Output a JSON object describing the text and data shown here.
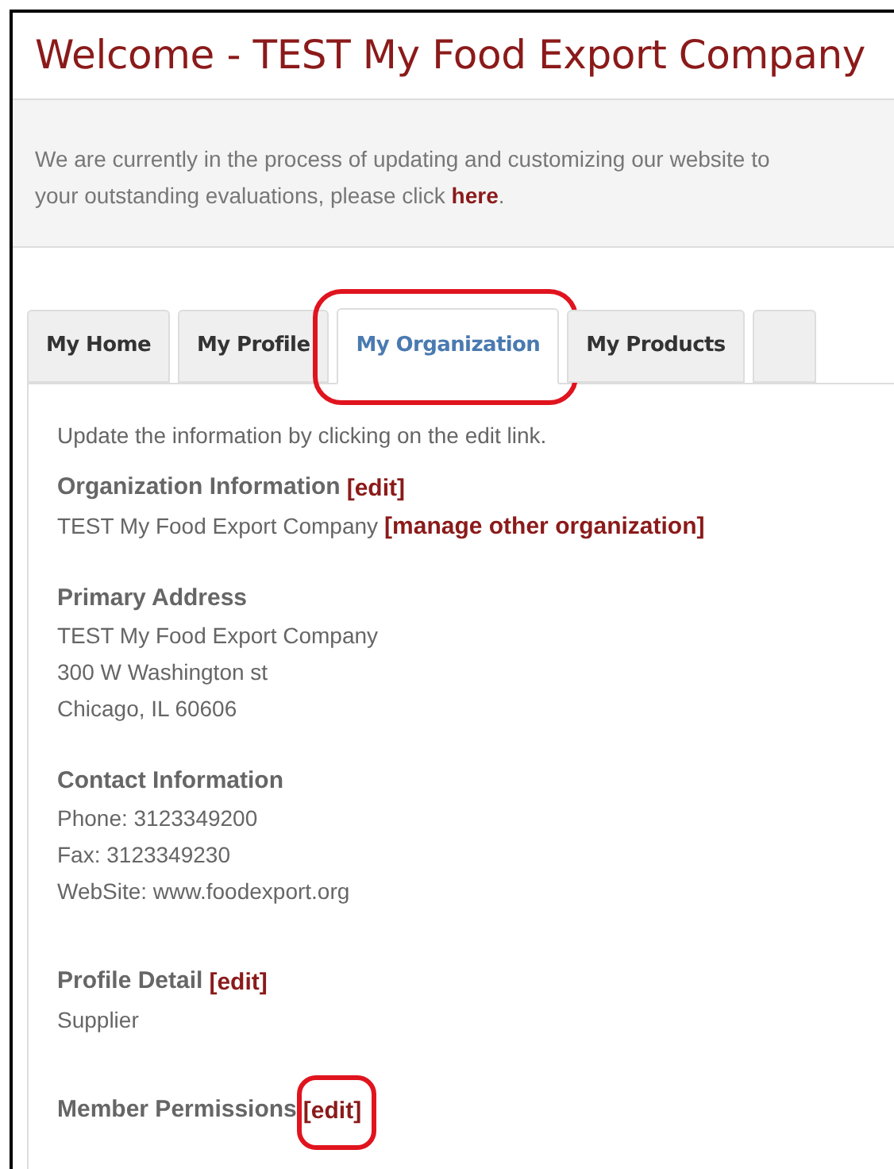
{
  "title": "Welcome - TEST My Food Export Company",
  "notice": {
    "lines": [
      "We are currently in the process of updating and customizing our website to",
      "your outstanding evaluations, please click"
    ],
    "link": "here",
    "after": "."
  },
  "tabs": [
    {
      "label": "My Home",
      "selected": false
    },
    {
      "label": "My Profile",
      "selected": false
    },
    {
      "label": "My Organization",
      "selected": true
    },
    {
      "label": "My Products",
      "selected": false
    }
  ],
  "intro": "Update the information by clicking on the edit link.",
  "sections": [
    {
      "title": "Organization Information",
      "edit": "[edit]",
      "lines": [
        {
          "text": "TEST My Food Export Company",
          "link": "[manage other organization]"
        }
      ]
    },
    {
      "title": "Primary Address",
      "lines": [
        {
          "text": "TEST My Food Export Company"
        },
        {
          "text": "300 W Washington st"
        },
        {
          "text": "Chicago, IL 60606"
        }
      ]
    },
    {
      "title": "Contact Information",
      "lines": [
        {
          "text": "Phone: 3123349200"
        },
        {
          "text": "Fax: 3123349230"
        },
        {
          "text": "WebSite: www.foodexport.org"
        }
      ]
    },
    {
      "title": "Profile Detail",
      "edit": "[edit]",
      "lines": [
        {
          "text": "Supplier"
        }
      ]
    },
    {
      "title": "Member Permissions",
      "edit": "[edit]"
    }
  ]
}
